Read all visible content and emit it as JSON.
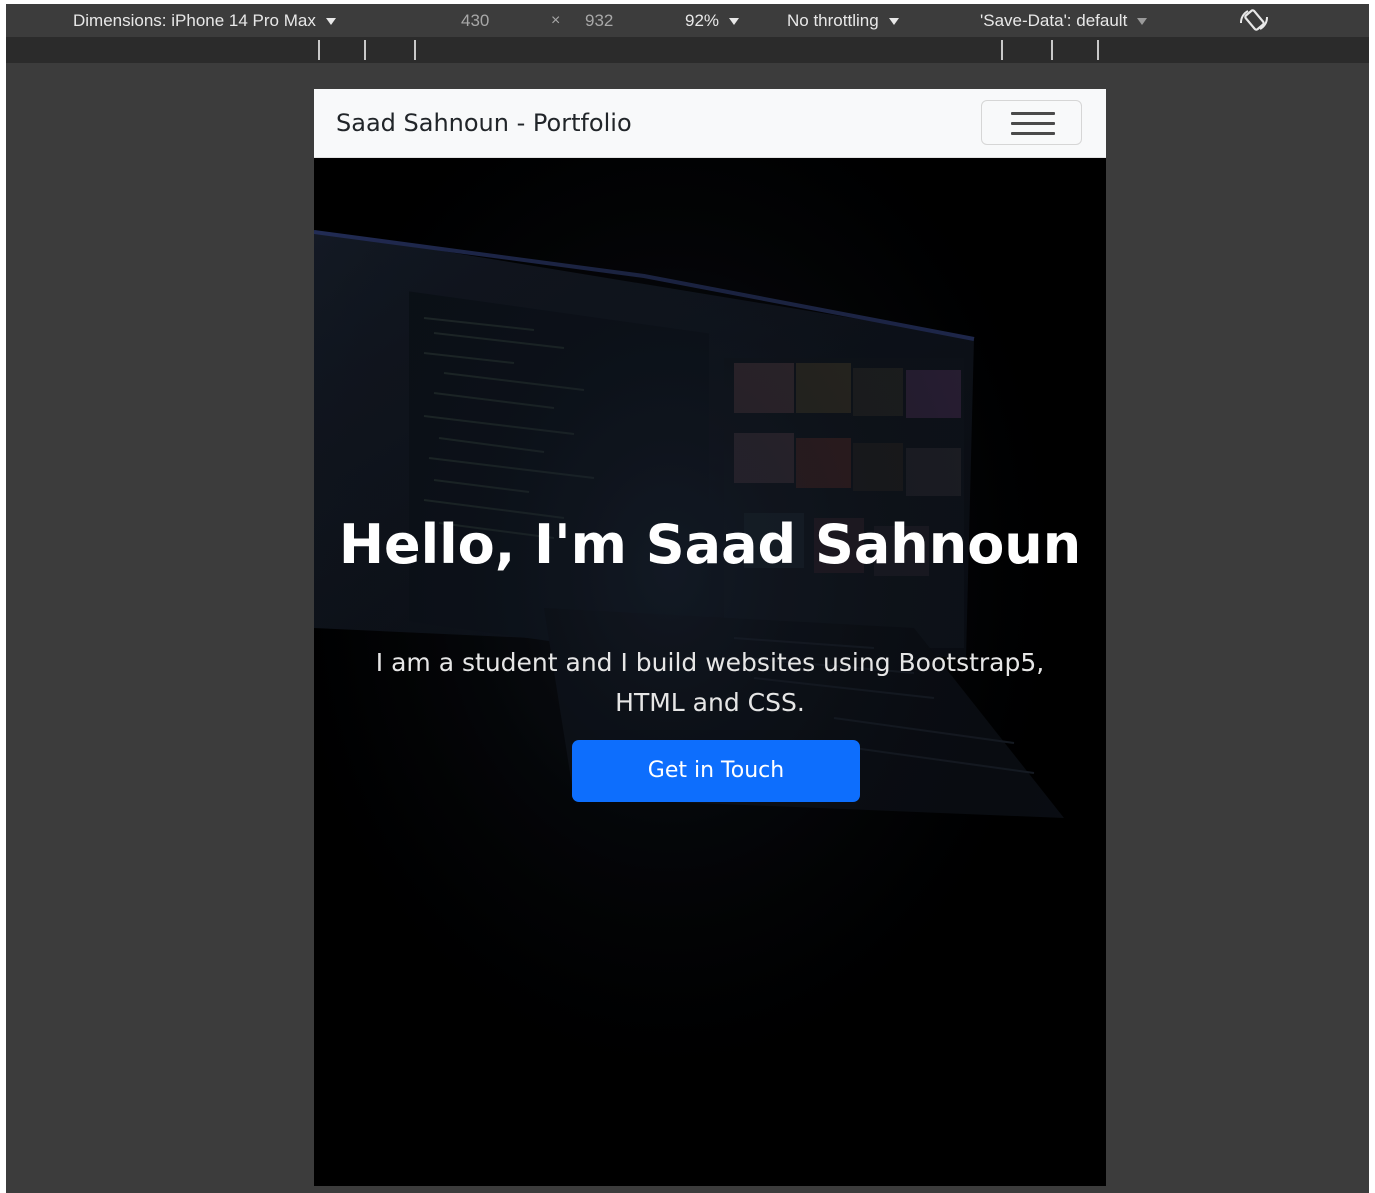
{
  "devtools": {
    "dimensions_label": "Dimensions: iPhone 14 Pro Max",
    "width_value": "430",
    "times_symbol": "×",
    "height_value": "932",
    "zoom": "92%",
    "throttling": "No throttling",
    "save_data": "'Save-Data': default"
  },
  "navbar": {
    "brand": "Saad Sahnoun - Portfolio",
    "toggler_icon": "hamburger-menu-icon"
  },
  "hero": {
    "heading": "Hello, I'm Saad Sahnoun",
    "lead": "I am a student and I build websites using Bootstrap5, HTML and CSS.",
    "cta_label": "Get in Touch"
  },
  "colors": {
    "devtools_background": "#3c3c3c",
    "ruler_background": "#2b2b2b",
    "navbar_background": "#f8f9fa",
    "hero_background": "#000000",
    "button_primary": "#0d6efd"
  }
}
